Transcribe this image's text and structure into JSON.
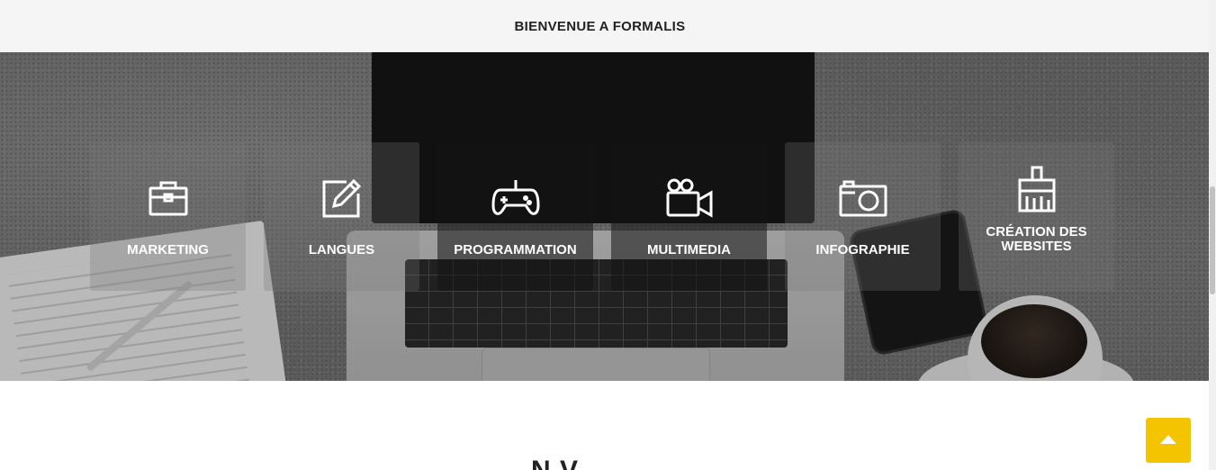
{
  "header": {
    "title": "BIENVENUE A FORMALIS"
  },
  "categories": [
    {
      "label": "MARKETING",
      "icon": "briefcase-icon"
    },
    {
      "label": "LANGUES",
      "icon": "pencil-square-icon"
    },
    {
      "label": "PROGRAMMATION",
      "icon": "gamepad-icon"
    },
    {
      "label": "MULTIMEDIA",
      "icon": "video-camera-icon"
    },
    {
      "label": "INFOGRAPHIE",
      "icon": "camera-icon"
    },
    {
      "label": "CRÉATION DES WEBSITES",
      "icon": "paint-brush-icon"
    }
  ],
  "section": {
    "title_partial": "N    V"
  },
  "scroll_top": {
    "icon": "caret-up-icon"
  },
  "colors": {
    "accent": "#f5c400",
    "topbar": "#f5f5f5"
  }
}
